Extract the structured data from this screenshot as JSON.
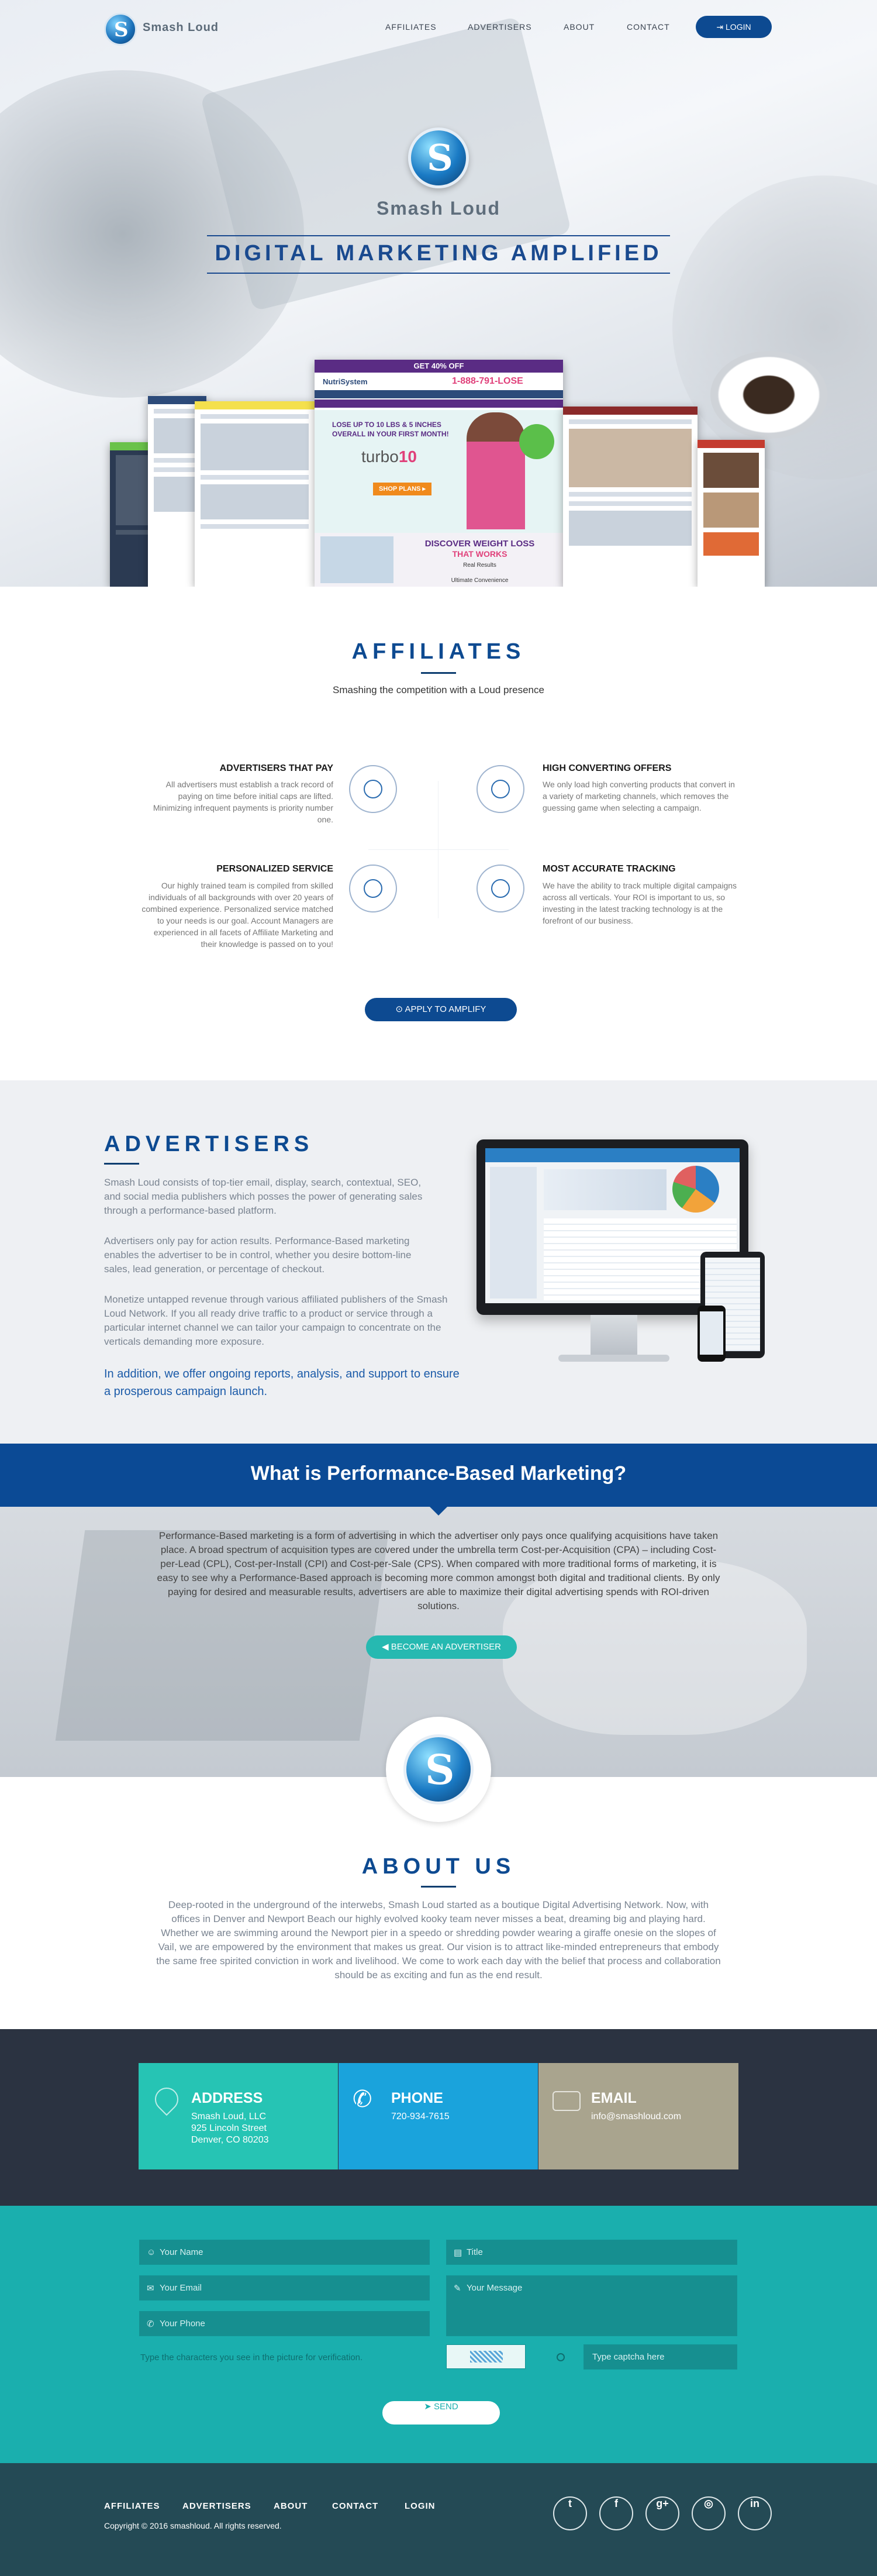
{
  "nav": {
    "brand": "Smash Loud",
    "items": [
      "AFFILIATES",
      "ADVERTISERS",
      "ABOUT",
      "CONTACT"
    ],
    "login": "LOGIN"
  },
  "hero": {
    "brand": "Smash Loud",
    "tagline": "DIGITAL MARKETING AMPLIFIED",
    "ad": {
      "top": "GET 40% OFF",
      "brand": "NutriSystem",
      "phone": "1-888-791-LOSE",
      "headline": "LOSE UP TO 10 LBS & 5 INCHES",
      "sub": "OVERALL IN YOUR FIRST MONTH!",
      "turbo": "turbo",
      "turbo_num": "10",
      "shop": "SHOP PLANS ▸",
      "discover": "DISCOVER WEIGHT LOSS",
      "works": "THAT WORKS",
      "results": "Real Results",
      "ultimate": "Ultimate Convenience"
    }
  },
  "affiliates": {
    "title": "AFFILIATES",
    "subtitle": "Smashing the competition with a Loud presence",
    "features": [
      {
        "title": "ADVERTISERS THAT PAY",
        "text": "All advertisers must establish a track record of paying on time before initial caps are lifted. Minimizing infrequent payments is priority number one."
      },
      {
        "title": "HIGH CONVERTING OFFERS",
        "text": "We only load high converting products that convert in a variety of marketing channels, which removes the guessing game when selecting a campaign."
      },
      {
        "title": "PERSONALIZED SERVICE",
        "text": "Our highly trained team is compiled from skilled individuals of all backgrounds with over 20 years of combined experience. Personalized service matched to your needs is our goal. Account Managers are experienced in all facets of Affiliate Marketing and their knowledge is passed on to you!"
      },
      {
        "title": "MOST ACCURATE TRACKING",
        "text": "We have the ability to track multiple digital campaigns across all verticals. Your ROI is important to us, so investing in the latest tracking technology is at the forefront of our business."
      }
    ],
    "button": "APPLY TO AMPLIFY"
  },
  "advertisers": {
    "title": "ADVERTISERS",
    "p1": "Smash Loud consists of top-tier email, display, search, contextual, SEO, and social media publishers which posses the power of generating sales through a performance-based platform.",
    "p2": "Advertisers only pay for action results. Performance-Based marketing enables the advertiser to be in control, whether you desire bottom-line sales, lead generation, or percentage of checkout.",
    "p3": "Monetize untapped revenue through various affiliated publishers of the Smash Loud Network. If you all ready drive traffic to a product or service through a particular internet channel we can tailor your campaign to concentrate on the verticals demanding more exposure.",
    "p4": "In addition, we offer ongoing reports, analysis, and support to ensure a prosperous campaign launch."
  },
  "performance": {
    "title": "What is Performance-Based Marketing?",
    "text": "Performance-Based marketing is a form of advertising in which the advertiser only pays once qualifying acquisitions have taken place. A broad spectrum of acquisition types are covered under the umbrella term Cost-per-Acquisition (CPA) – including Cost-per-Lead (CPL), Cost-per-Install (CPI) and Cost-per-Sale (CPS). When compared with more traditional forms of marketing, it is easy to see why a Performance-Based approach is becoming more common amongst both digital and traditional clients. By only paying for desired and measurable results, advertisers are able to maximize their digital advertising spends with ROI-driven solutions.",
    "button": "BECOME AN ADVERTISER"
  },
  "about": {
    "title": "ABOUT US",
    "text": "Deep-rooted in the underground of the interwebs, Smash Loud started as a boutique Digital Advertising Network. Now, with offices in Denver and Newport Beach our highly evolved kooky team never misses a beat, dreaming big and playing hard. Whether we are swimming around the Newport pier in a speedo or shredding powder wearing a giraffe onesie on the slopes of Vail, we are empowered by the environment that makes us great. Our vision is to attract like-minded entrepreneurs that embody the same free spirited conviction in work and livelihood. We come to work each day with the belief that process and collaboration should be as exciting and fun as the end result."
  },
  "contact": {
    "address": {
      "title": "ADDRESS",
      "line1": "Smash Loud, LLC",
      "line2": "925 Lincoln Street",
      "line3": "Denver, CO 80203",
      "color": "#26c4b4"
    },
    "phone": {
      "title": "PHONE",
      "line1": "720-934-7615",
      "color": "#1aa3dc"
    },
    "email": {
      "title": "EMAIL",
      "line1": "info@smashloud.com",
      "color": "#a9a48e"
    }
  },
  "form": {
    "name": "Your Name",
    "title": "Title",
    "email": "Your Email",
    "message": "Your Message",
    "phone": "Your Phone",
    "captcha_label": "Type the characters you see in the picture for verification.",
    "captcha_placeholder": "Type captcha here",
    "send": "SEND"
  },
  "footer": {
    "links": [
      "AFFILIATES",
      "ADVERTISERS",
      "ABOUT",
      "CONTACT",
      "LOGIN"
    ],
    "copyright": "Copyright © 2016 smashloud. All rights reserved.",
    "social": [
      "twitter-icon",
      "facebook-icon",
      "google-plus-icon",
      "instagram-icon",
      "linkedin-icon"
    ]
  }
}
